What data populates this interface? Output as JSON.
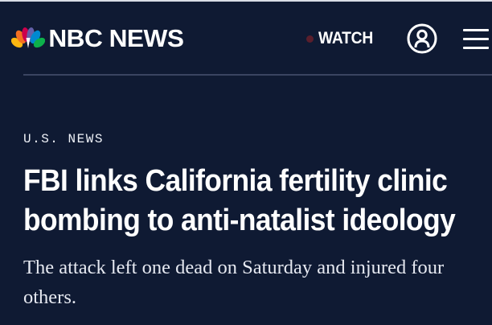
{
  "header": {
    "brand": "NBC NEWS",
    "watch_label": "WATCH",
    "icons": [
      "peacock-logo",
      "live-dot",
      "account-icon",
      "menu-icon"
    ]
  },
  "article": {
    "section": "U.S. NEWS",
    "headline_line1": "FBI links California fertility clinic",
    "headline_line2": "bombing to anti-natalist ideology",
    "dek": "The attack left one dead on Saturday and injured four others."
  },
  "colors": {
    "background": "#0f1a33",
    "text": "#ffffff",
    "divider": "#3a4461",
    "live_dot": "#5a1e2c"
  }
}
